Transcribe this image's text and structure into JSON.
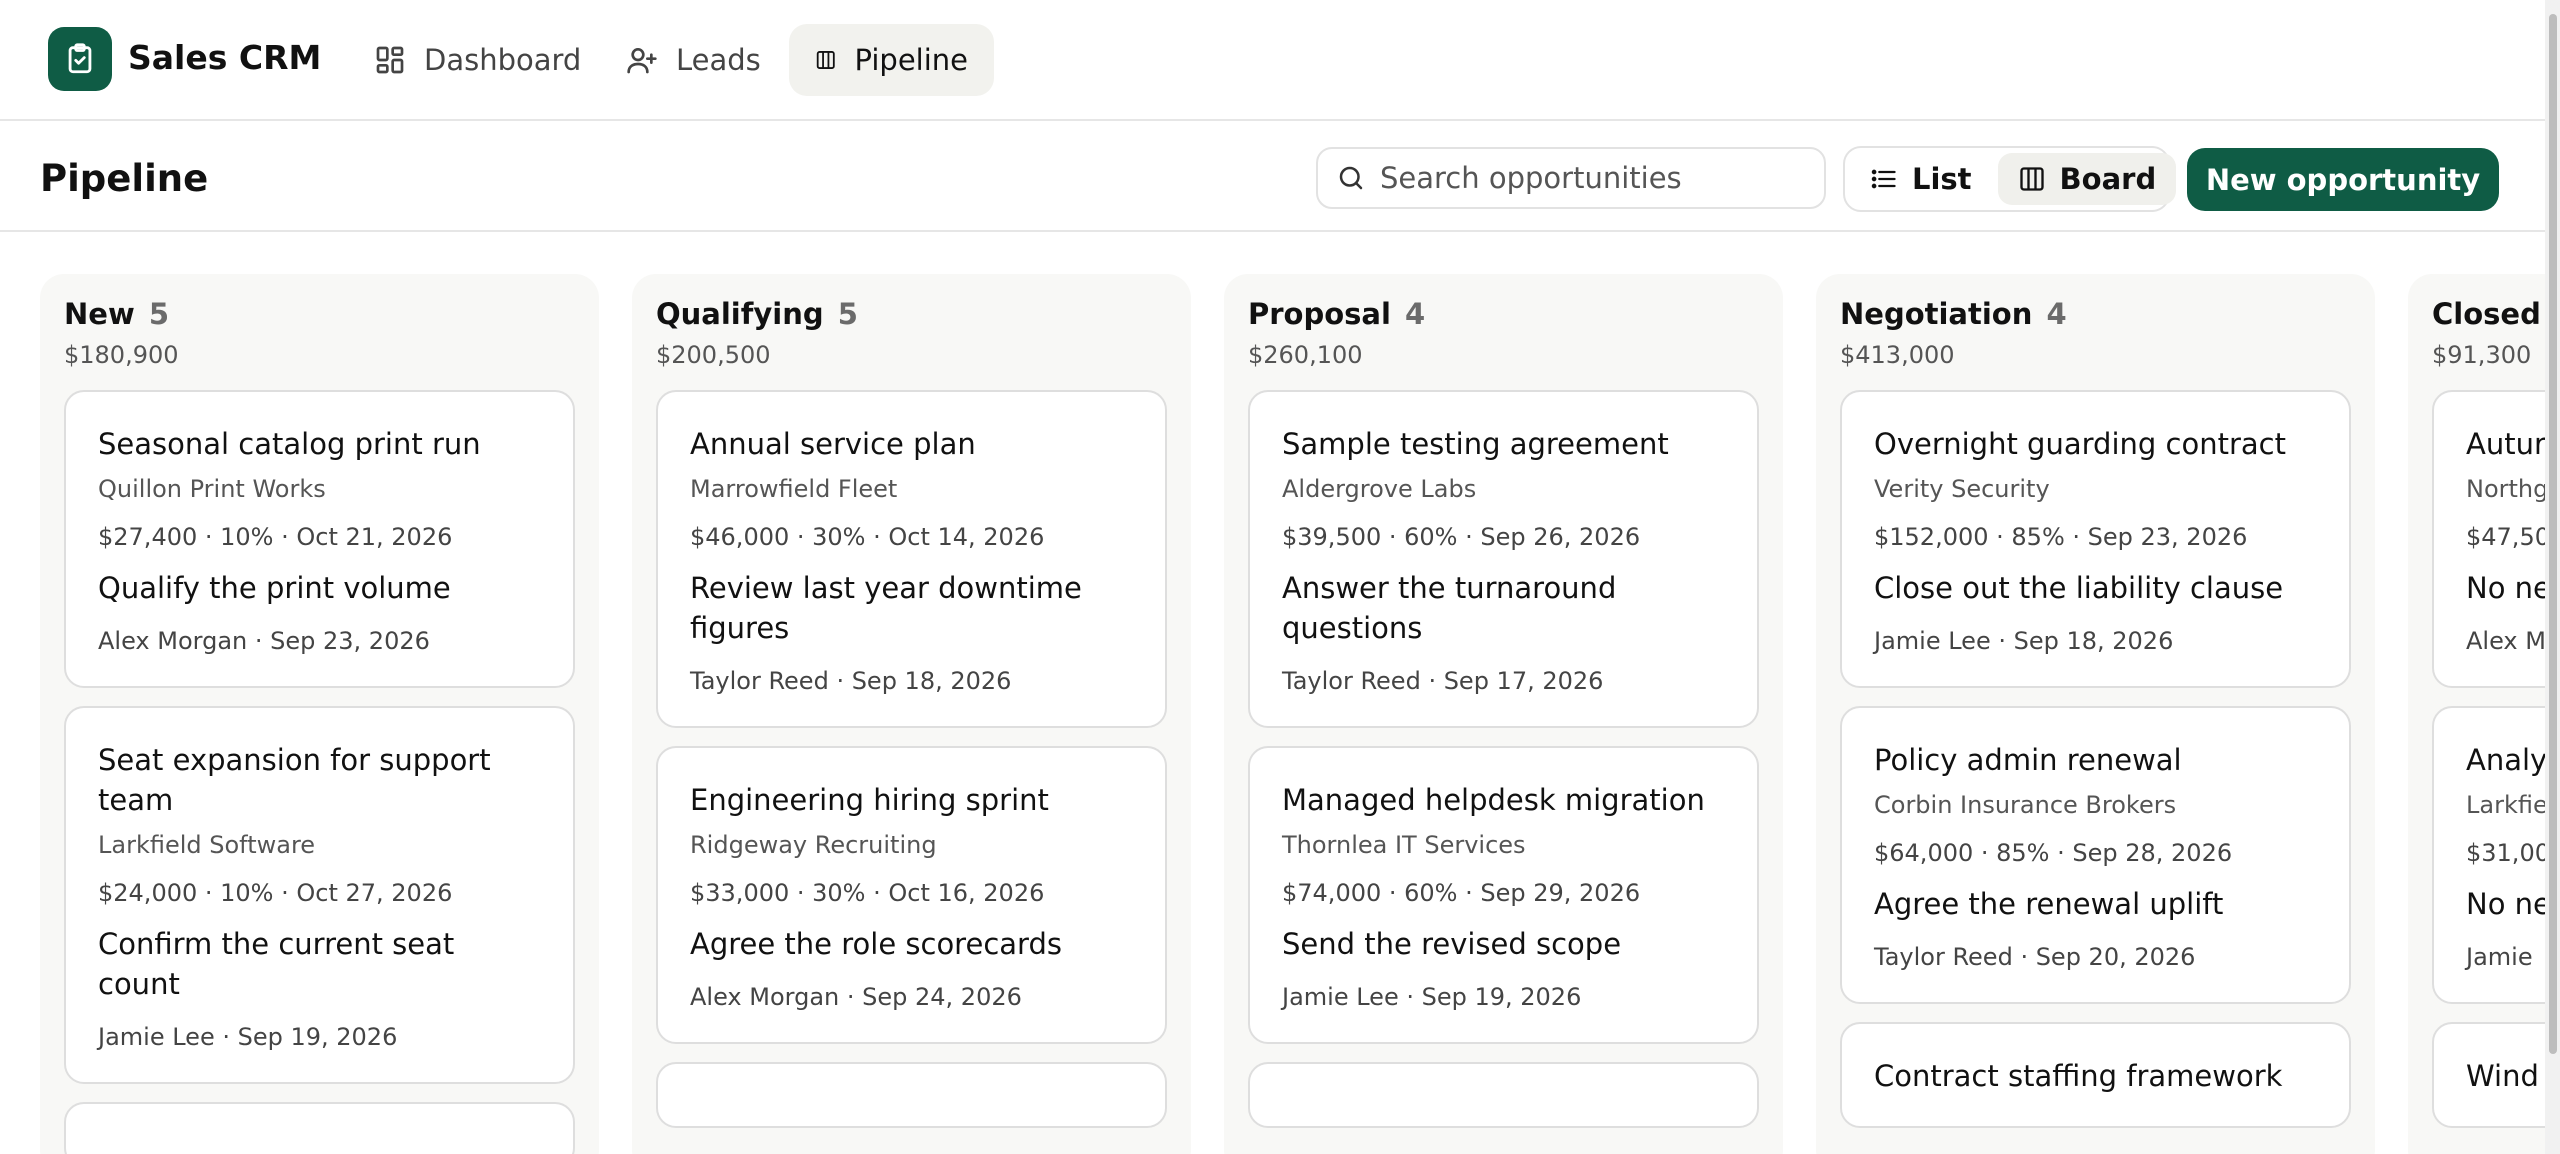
{
  "brand": {
    "name": "Sales CRM",
    "icon": "clipboard-check-icon"
  },
  "nav": [
    {
      "label": "Dashboard",
      "icon": "dashboard-icon",
      "active": false
    },
    {
      "label": "Leads",
      "icon": "user-plus-icon",
      "active": false
    },
    {
      "label": "Pipeline",
      "icon": "columns-icon",
      "active": true
    }
  ],
  "page": {
    "title": "Pipeline"
  },
  "search": {
    "placeholder": "Search opportunities"
  },
  "view": {
    "list_label": "List",
    "board_label": "Board",
    "active": "Board"
  },
  "actions": {
    "new_label": "New opportunity"
  },
  "colors": {
    "accent": "#0f5c45",
    "column_bg": "#f8f8f6"
  },
  "columns": [
    {
      "name": "New",
      "count": "5",
      "total": "$180,900",
      "cards": [
        {
          "title": "Seasonal catalog print run",
          "company": "Quillon Print Works",
          "meta": "$27,400 · 10% · Oct 21, 2026",
          "next": "Qualify the print volume",
          "owner": "Alex Morgan · Sep 23, 2026"
        },
        {
          "title": "Seat expansion for support team",
          "company": "Larkfield Software",
          "meta": "$24,000 · 10% · Oct 27, 2026",
          "next": "Confirm the current seat count",
          "owner": "Jamie Lee · Sep 19, 2026"
        },
        {
          "title": "",
          "company": "",
          "meta": "",
          "next": "",
          "owner": ""
        }
      ]
    },
    {
      "name": "Qualifying",
      "count": "5",
      "total": "$200,500",
      "cards": [
        {
          "title": "Annual service plan",
          "company": "Marrowfield Fleet",
          "meta": "$46,000 · 30% · Oct 14, 2026",
          "next": "Review last year downtime figures",
          "owner": "Taylor Reed · Sep 18, 2026"
        },
        {
          "title": "Engineering hiring sprint",
          "company": "Ridgeway Recruiting",
          "meta": "$33,000 · 30% · Oct 16, 2026",
          "next": "Agree the role scorecards",
          "owner": "Alex Morgan · Sep 24, 2026"
        },
        {
          "title": "",
          "company": "",
          "meta": "",
          "next": "",
          "owner": ""
        }
      ]
    },
    {
      "name": "Proposal",
      "count": "4",
      "total": "$260,100",
      "cards": [
        {
          "title": "Sample testing agreement",
          "company": "Aldergrove Labs",
          "meta": "$39,500 · 60% · Sep 26, 2026",
          "next": "Answer the turnaround questions",
          "owner": "Taylor Reed · Sep 17, 2026"
        },
        {
          "title": "Managed helpdesk migration",
          "company": "Thornlea IT Services",
          "meta": "$74,000 · 60% · Sep 29, 2026",
          "next": "Send the revised scope",
          "owner": "Jamie Lee · Sep 19, 2026"
        },
        {
          "title": "",
          "company": "",
          "meta": "",
          "next": "",
          "owner": ""
        }
      ]
    },
    {
      "name": "Negotiation",
      "count": "4",
      "total": "$413,000",
      "cards": [
        {
          "title": "Overnight guarding contract",
          "company": "Verity Security",
          "meta": "$152,000 · 85% · Sep 23, 2026",
          "next": "Close out the liability clause",
          "owner": "Jamie Lee · Sep 18, 2026"
        },
        {
          "title": "Policy admin renewal",
          "company": "Corbin Insurance Brokers",
          "meta": "$64,000 · 85% · Sep 28, 2026",
          "next": "Agree the renewal uplift",
          "owner": "Taylor Reed · Sep 20, 2026"
        },
        {
          "title": "Contract staffing framework",
          "company": "",
          "meta": "",
          "next": "",
          "owner": ""
        }
      ]
    },
    {
      "name": "Closed",
      "count": "",
      "total": "$91,300",
      "cards": [
        {
          "title": "Autur",
          "company": "Northg",
          "meta": "$47,50",
          "next": "No ne",
          "owner": "Alex M"
        },
        {
          "title": "Analy",
          "company": "Larkfie",
          "meta": "$31,00",
          "next": "No ne",
          "owner": "Jamie"
        },
        {
          "title": "Wind",
          "company": "",
          "meta": "",
          "next": "",
          "owner": ""
        }
      ]
    }
  ]
}
